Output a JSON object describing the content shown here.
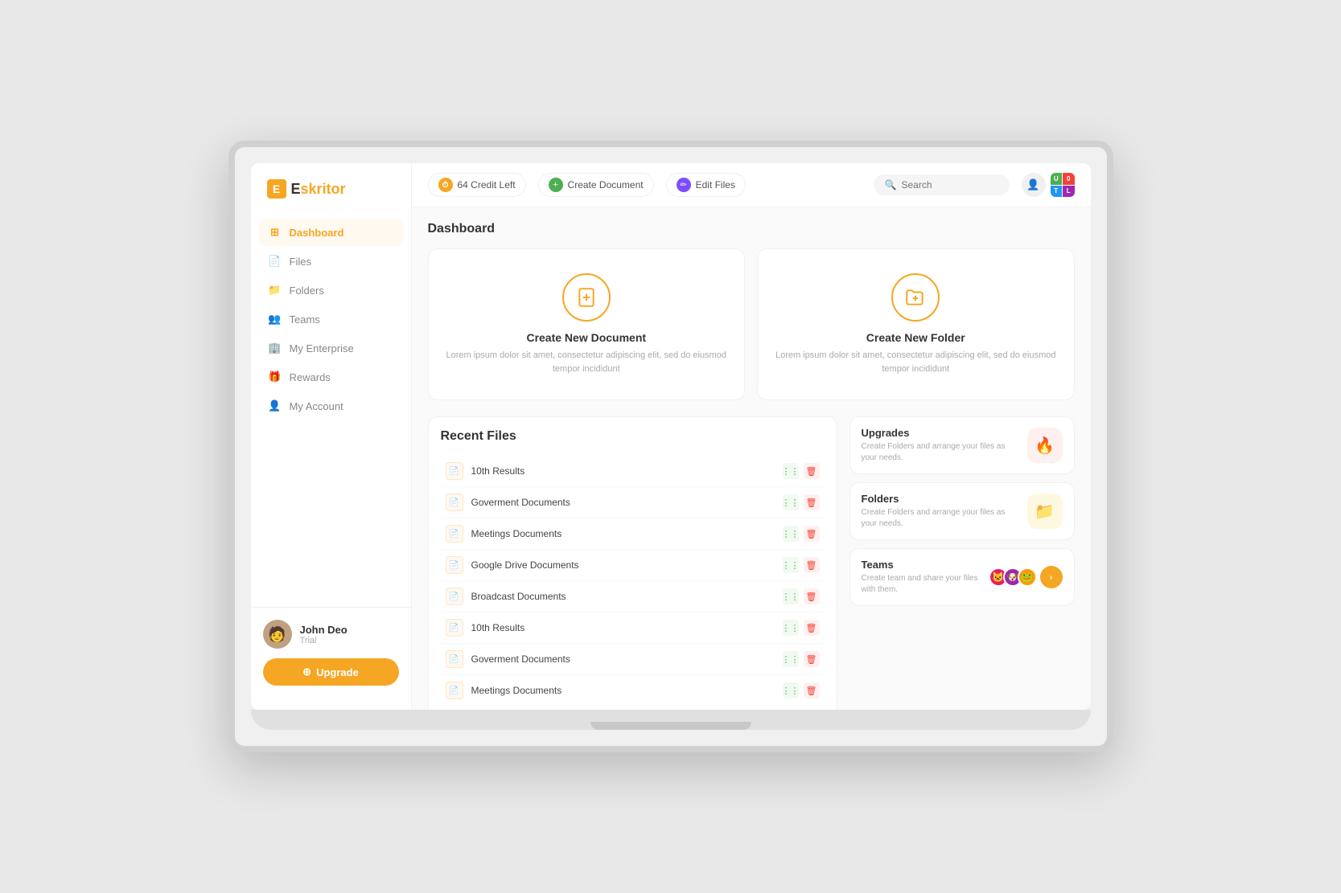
{
  "logo": {
    "letter": "E",
    "text_before": "",
    "text_after": "skritor"
  },
  "topbar": {
    "credit_label": "64 Credit Left",
    "create_doc_label": "Create Document",
    "edit_files_label": "Edit Files",
    "search_placeholder": "Search"
  },
  "sidebar": {
    "nav_items": [
      {
        "id": "dashboard",
        "label": "Dashboard",
        "active": true
      },
      {
        "id": "files",
        "label": "Files"
      },
      {
        "id": "folders",
        "label": "Folders"
      },
      {
        "id": "teams",
        "label": "Teams"
      },
      {
        "id": "enterprise",
        "label": "My Enterprise"
      },
      {
        "id": "rewards",
        "label": "Rewards"
      },
      {
        "id": "account",
        "label": "My Account"
      }
    ],
    "user": {
      "name": "John Deo",
      "plan": "Trial"
    },
    "upgrade_label": "Upgrade"
  },
  "dashboard": {
    "title": "Dashboard",
    "action_cards": [
      {
        "id": "create-doc",
        "title": "Create New Document",
        "desc": "Lorem ipsum dolor sit amet, consectetur adipiscing elit, sed do eiusmod tempor incididunt"
      },
      {
        "id": "create-folder",
        "title": "Create New Folder",
        "desc": "Lorem ipsum dolor sit amet, consectetur adipiscing elit, sed do eiusmod tempor incididunt"
      }
    ],
    "recent_files_title": "Recent Files",
    "recent_files": [
      {
        "name": "10th Results"
      },
      {
        "name": "Goverment Documents"
      },
      {
        "name": "Meetings Documents"
      },
      {
        "name": "Google Drive Documents"
      },
      {
        "name": "Broadcast Documents"
      },
      {
        "name": "10th Results"
      },
      {
        "name": "Goverment Documents"
      },
      {
        "name": "Meetings Documents"
      }
    ],
    "promo_cards": [
      {
        "id": "upgrades",
        "title": "Upgrades",
        "desc": "Create Folders and arrange your files as your needs."
      },
      {
        "id": "folders",
        "title": "Folders",
        "desc": "Create Folders and arrange your files as your needs."
      },
      {
        "id": "teams",
        "title": "Teams",
        "desc": "Create team and share your files with them."
      }
    ]
  },
  "tls": {
    "cells": [
      {
        "label": "U",
        "bg": "#4caf50"
      },
      {
        "label": "0",
        "bg": "#f44336"
      },
      {
        "label": "T",
        "bg": "#2196f3"
      },
      {
        "label": "L",
        "bg": "#9c27b0"
      }
    ]
  }
}
